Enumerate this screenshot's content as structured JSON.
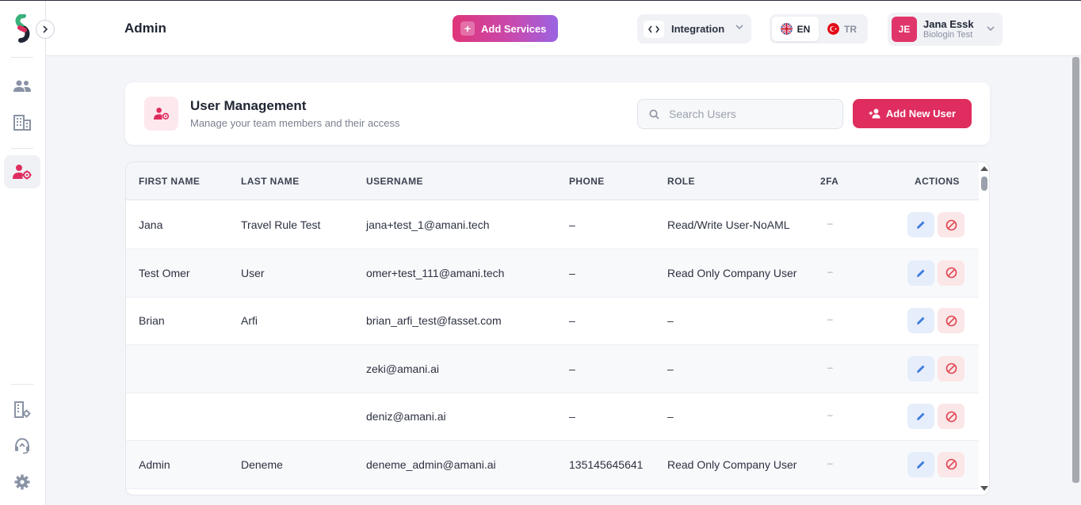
{
  "header": {
    "title": "Admin",
    "add_services_label": "Add Services",
    "integration_label": "Integration",
    "languages": [
      {
        "code": "EN",
        "active": true
      },
      {
        "code": "TR",
        "active": false
      }
    ],
    "user": {
      "initials": "JE",
      "name": "Jana Essk",
      "org": "Biologin Test"
    }
  },
  "sidebar": {
    "items": [
      {
        "name": "users-icon",
        "active": false
      },
      {
        "name": "building-icon",
        "active": false
      },
      {
        "name": "user-settings-icon",
        "active": true
      }
    ],
    "bottom_items": [
      {
        "name": "building-settings-icon"
      },
      {
        "name": "support-headset-icon"
      },
      {
        "name": "gear-icon"
      }
    ]
  },
  "user_management": {
    "title": "User Management",
    "subtitle": "Manage your team members and their access",
    "search_placeholder": "Search Users",
    "add_button_label": "Add New User"
  },
  "table": {
    "columns": [
      "FIRST NAME",
      "LAST NAME",
      "USERNAME",
      "PHONE",
      "ROLE",
      "2FA",
      "ACTIONS"
    ],
    "rows": [
      {
        "first": "Jana",
        "last": "Travel Rule Test",
        "username": "jana+test_1@amani.tech",
        "phone": "–",
        "role": "Read/Write User-NoAML",
        "twofa": "–"
      },
      {
        "first": "Test Omer",
        "last": "User",
        "username": "omer+test_111@amani.tech",
        "phone": "–",
        "role": "Read Only Company User",
        "twofa": "–"
      },
      {
        "first": "Brian",
        "last": "Arfi",
        "username": "brian_arfi_test@fasset.com",
        "phone": "–",
        "role": "–",
        "twofa": "–"
      },
      {
        "first": "",
        "last": "",
        "username": "zeki@amani.ai",
        "phone": "–",
        "role": "–",
        "twofa": "–"
      },
      {
        "first": "",
        "last": "",
        "username": "deniz@amani.ai",
        "phone": "–",
        "role": "–",
        "twofa": "–"
      },
      {
        "first": "Admin",
        "last": "Deneme",
        "username": "deneme_admin@amani.ai",
        "phone": "135145645641",
        "role": "Read Only Company User",
        "twofa": "–"
      }
    ]
  },
  "colors": {
    "brand_pink": "#de2d5e",
    "edit_blue": "#3b7be0",
    "delete_red": "#e0454f"
  }
}
